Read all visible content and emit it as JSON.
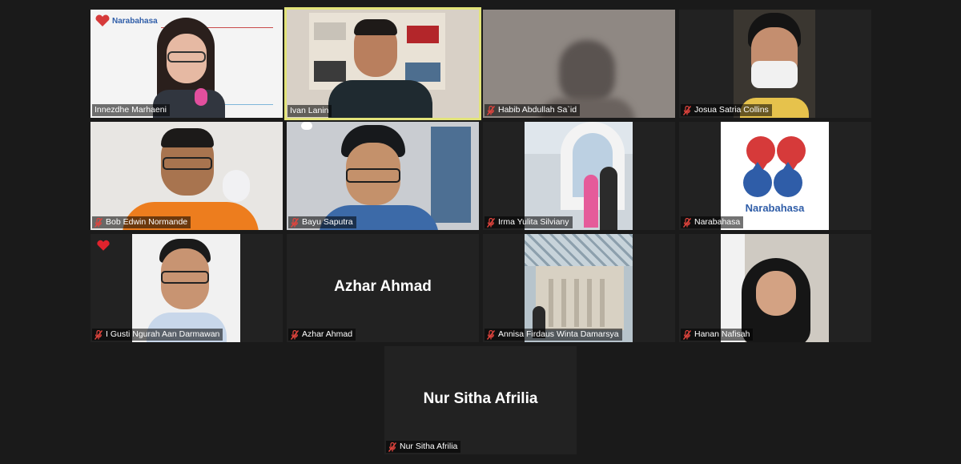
{
  "participants": [
    {
      "name": "Innezdhe Marhaeni",
      "muted": false,
      "logo_text": "Narabahasa"
    },
    {
      "name": "Ivan Lanin",
      "muted": false,
      "active_speaker": true
    },
    {
      "name": "Habib Abdullah Sa`id",
      "muted": true
    },
    {
      "name": "Josua Satria Collins",
      "muted": true
    },
    {
      "name": "Bob Edwin Normande",
      "muted": true
    },
    {
      "name": "Bayu Saputra",
      "muted": true
    },
    {
      "name": "Irma Yulita Silviany",
      "muted": true
    },
    {
      "name": "Narabahasa",
      "muted": true,
      "logo_text": "Narabahasa"
    },
    {
      "name": "I Gusti Ngurah Aan Darmawan",
      "muted": true,
      "badge": "heart-icon"
    },
    {
      "name": "Azhar Ahmad",
      "muted": true,
      "video_off": true
    },
    {
      "name": "Annisa Firdaus Winta Damarsya",
      "muted": true
    },
    {
      "name": "Hanan Nafisah",
      "muted": true
    },
    {
      "name": "Nur Sitha Afrilia",
      "muted": true,
      "video_off": true
    }
  ],
  "colors": {
    "background": "#1a1a1a",
    "tile": "#222222",
    "active_border": "#e3e47a",
    "mute": "#e0443d",
    "brand_red": "#d63a3a",
    "brand_blue": "#2f5da8"
  }
}
